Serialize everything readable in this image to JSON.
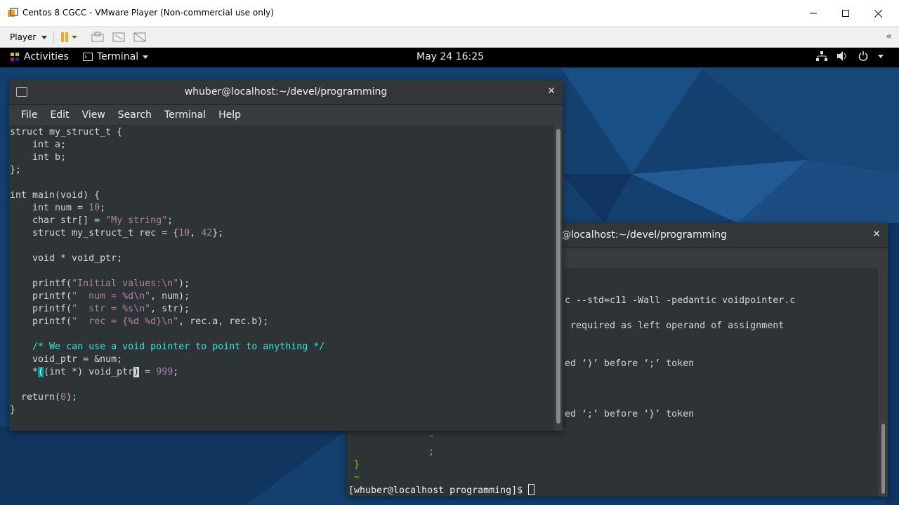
{
  "vm": {
    "title": "Centos 8 CGCC - VMware Player (Non-commercial use only)",
    "player_label": "Player"
  },
  "topbar": {
    "activities": "Activities",
    "app": "Terminal",
    "clock": "May 24  16:25"
  },
  "front_terminal": {
    "title": "whuber@localhost:~/devel/programming",
    "menu": [
      "File",
      "Edit",
      "View",
      "Search",
      "Terminal",
      "Help"
    ]
  },
  "back_terminal": {
    "title": "@localhost:~/devel/programming",
    "lines": [
      "c --std=c11 -Wall -pedantic voidpointer.c",
      " required as left operand of assignment",
      "ed ‘)’ before ‘;’ token",
      "ed ‘;’ before ‘}’ token"
    ],
    "prompt": "[whuber@localhost programming]$ "
  },
  "colors": {
    "terminal_bg": "#2e3436",
    "accent": "#34e2e2"
  }
}
